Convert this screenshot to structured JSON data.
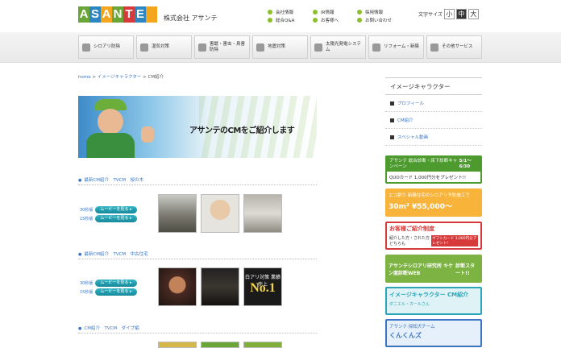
{
  "header": {
    "logo_text": "ASANTE",
    "company": "株式会社 アサンテ",
    "links_col1": [
      "会社情報",
      "総合Q&A"
    ],
    "links_col2": [
      "IR情報",
      "お客様へ"
    ],
    "links_col3": [
      "採用情報",
      "お問い合わせ"
    ],
    "font_size_label": "文字サイズ",
    "font_sizes": [
      "小",
      "中",
      "大"
    ]
  },
  "nav": [
    "シロアリ防除",
    "湿気対策",
    "害獣・害虫・鳥害防除",
    "地震対策",
    "太陽光発電システム",
    "リフォーム・新築",
    "その他サービス"
  ],
  "breadcrumb": {
    "home": "home",
    "sep": ">",
    "parent": "イメージキャラクター",
    "current": "CM紹介"
  },
  "hero": {
    "caption": "アサンテのCMをご紹介します"
  },
  "sections": [
    {
      "title": "最新CM紹介　TVCM　桜の木",
      "rows": [
        {
          "label": "30秒版",
          "button": "ムービーを見る ▸"
        },
        {
          "label": "15秒版",
          "button": "ムービーを見る ▸"
        }
      ]
    },
    {
      "title": "最新CM紹介　TVCM　中古住宅",
      "rows": [
        {
          "label": "30秒版",
          "button": "ムービーを見る ▸"
        },
        {
          "label": "15秒版",
          "button": "ムービーを見る ▸"
        }
      ],
      "thumb_text": {
        "top": "白アリ対策 業績売上",
        "big": "No.1"
      }
    },
    {
      "title": "CM紹介　TVCM　ダイブ編"
    }
  ],
  "sidebar": {
    "heading": "イメージキャラクター",
    "links": [
      "プロフィール",
      "CM紹介",
      "スペシャル動画"
    ]
  },
  "banners": [
    {
      "text": "アサンテ 総合診断・床下診断キャンペーン",
      "sub": "5/1〜6/30",
      "extra": "QUOカード 1,000円分をプレゼント!!",
      "color": "#4d9a2f"
    },
    {
      "text": "エコ割り 新築住宅のシロアリ予防施工で",
      "sub": "30m² ¥55,000〜",
      "color": "#f2a51d"
    },
    {
      "text": "お客様ご紹介制度",
      "sub": "紹介した方・された方どちらも",
      "extra": "ギフトカード 3,000円分プレゼント!",
      "color": "#d73a3a"
    },
    {
      "text": "アサンテシロアリ研究所 キケン度診断WEB",
      "sub": "診断スタート!!",
      "color": "#6aa637"
    },
    {
      "text": "イメージキャラクター CM紹介",
      "sub": "ダニエル・カールさん",
      "color": "#2aa6b8"
    },
    {
      "text": "アサンテ 探知犬チーム",
      "sub": "くんくんズ",
      "color": "#3a75c4"
    }
  ],
  "colors": {
    "accent_green": "#8cbf2a",
    "link_blue": "#3a75c4",
    "button_teal": "#1b97a8"
  }
}
